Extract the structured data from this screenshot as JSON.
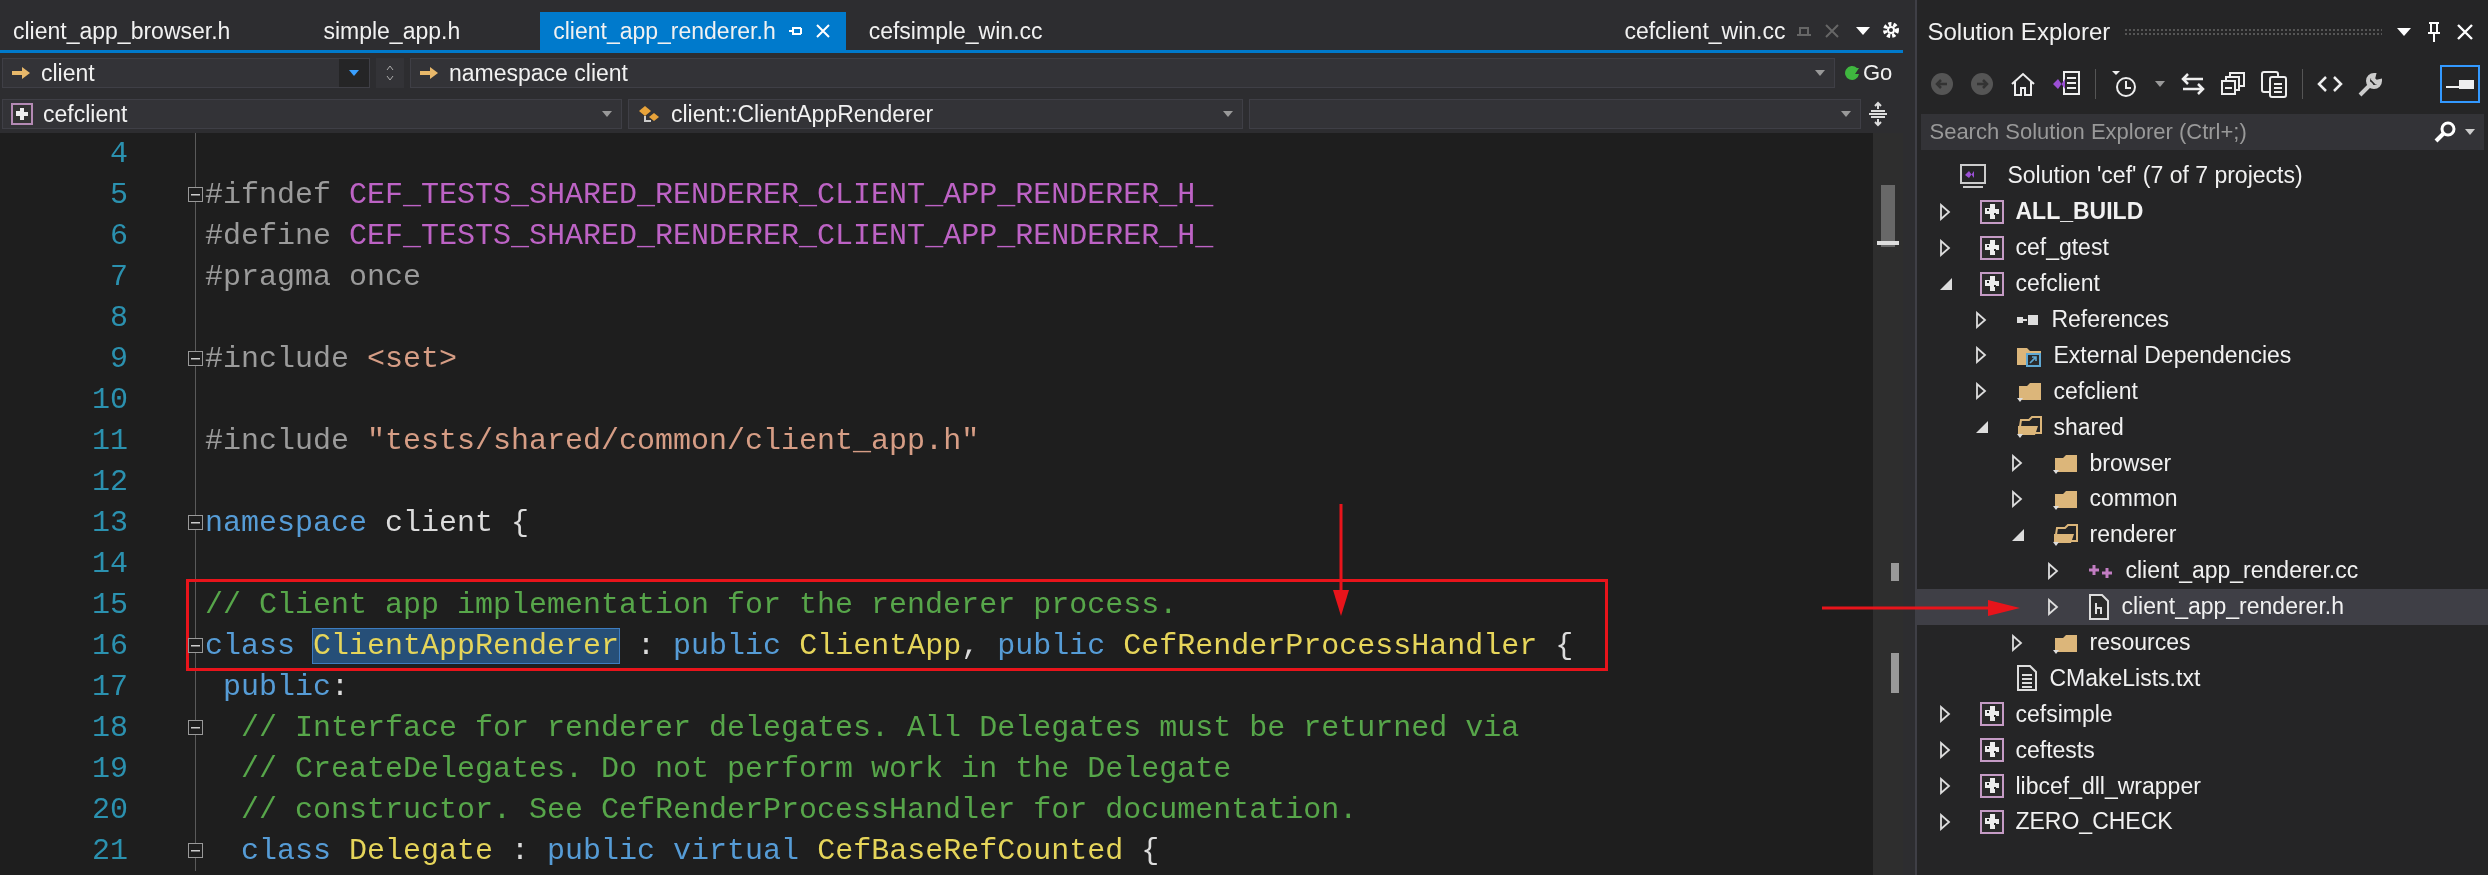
{
  "tabs": [
    {
      "label": "client_app_browser.h",
      "selected": false,
      "preview": false
    },
    {
      "label": "simple_app.h",
      "selected": false,
      "preview": false
    },
    {
      "label": "client_app_renderer.h",
      "selected": true,
      "preview": false
    },
    {
      "label": "cefsimple_win.cc",
      "selected": false,
      "preview": false
    },
    {
      "label": "cefclient_win.cc",
      "selected": false,
      "preview": true
    }
  ],
  "navigation_bar": {
    "scope": "client",
    "member": "namespace client",
    "go_button": "Go"
  },
  "context_bar": {
    "project": "cefclient",
    "type": "client::ClientAppRenderer"
  },
  "code_lines": [
    {
      "number": "4",
      "collapsible": false
    },
    {
      "number": "5",
      "collapsible": true,
      "tokens": [
        {
          "kind": "preproc",
          "text": "#ifndef "
        },
        {
          "kind": "macro",
          "text": "CEF_TESTS_SHARED_RENDERER_CLIENT_APP_RENDERER_H_"
        }
      ]
    },
    {
      "number": "6",
      "collapsible": false,
      "tokens": [
        {
          "kind": "preproc",
          "text": "#define "
        },
        {
          "kind": "macro",
          "text": "CEF_TESTS_SHARED_RENDERER_CLIENT_APP_RENDERER_H_"
        }
      ]
    },
    {
      "number": "7",
      "collapsible": false,
      "tokens": [
        {
          "kind": "preproc",
          "text": "#pragma once"
        }
      ]
    },
    {
      "number": "8",
      "collapsible": false
    },
    {
      "number": "9",
      "collapsible": true,
      "tokens": [
        {
          "kind": "preproc",
          "text": "#include "
        },
        {
          "kind": "string",
          "text": "<set>"
        }
      ]
    },
    {
      "number": "10",
      "collapsible": false
    },
    {
      "number": "11",
      "collapsible": false,
      "tokens": [
        {
          "kind": "preproc",
          "text": "#include "
        },
        {
          "kind": "string",
          "text": "\"tests/shared/common/client_app.h\""
        }
      ]
    },
    {
      "number": "12",
      "collapsible": false
    },
    {
      "number": "13",
      "collapsible": true,
      "tokens": [
        {
          "kind": "keyword",
          "text": "namespace"
        },
        {
          "kind": "plain",
          "text": " client {"
        }
      ]
    },
    {
      "number": "14",
      "collapsible": false
    },
    {
      "number": "15",
      "collapsible": false,
      "tokens": [
        {
          "kind": "comment",
          "text": "// Client app implementation for the renderer process."
        }
      ]
    },
    {
      "number": "16",
      "collapsible": true,
      "tokens": [
        {
          "kind": "keyword",
          "text": "class "
        },
        {
          "kind": "selection",
          "text": "ClientAppRenderer"
        },
        {
          "kind": "plain",
          "text": " : "
        },
        {
          "kind": "keyword",
          "text": "public "
        },
        {
          "kind": "type",
          "text": "ClientApp"
        },
        {
          "kind": "plain",
          "text": ", "
        },
        {
          "kind": "keyword",
          "text": "public "
        },
        {
          "kind": "type",
          "text": "CefRenderProcessHandler"
        },
        {
          "kind": "plain",
          "text": " {"
        }
      ]
    },
    {
      "number": "17",
      "collapsible": false,
      "tokens": [
        {
          "kind": "keyword",
          "text": " public"
        },
        {
          "kind": "plain",
          "text": ":"
        }
      ]
    },
    {
      "number": "18",
      "collapsible": true,
      "tokens": [
        {
          "kind": "comment",
          "text": "  // Interface for renderer delegates. All Delegates must be returned via"
        }
      ]
    },
    {
      "number": "19",
      "collapsible": false,
      "tokens": [
        {
          "kind": "comment",
          "text": "  // CreateDelegates. Do not perform work in the Delegate"
        }
      ]
    },
    {
      "number": "20",
      "collapsible": false,
      "tokens": [
        {
          "kind": "comment",
          "text": "  // constructor. See CefRenderProcessHandler for documentation."
        }
      ]
    },
    {
      "number": "21",
      "collapsible": true,
      "tokens": [
        {
          "kind": "keyword",
          "text": "  class "
        },
        {
          "kind": "type",
          "text": "Delegate"
        },
        {
          "kind": "plain",
          "text": " : "
        },
        {
          "kind": "keyword",
          "text": "public virtual "
        },
        {
          "kind": "type",
          "text": "CefBaseRefCounted"
        },
        {
          "kind": "plain",
          "text": " {"
        }
      ]
    }
  ],
  "solution_explorer": {
    "title": "Solution Explorer",
    "search": {
      "placeholder": "Search Solution Explorer (Ctrl+;)"
    },
    "solution": {
      "label": "Solution 'cef' (7 of 7 projects)",
      "children": [
        {
          "label": "ALL_BUILD",
          "kind": "startup-project",
          "expanded": false,
          "selected": false
        },
        {
          "label": "cef_gtest",
          "kind": "project",
          "expanded": false,
          "selected": false
        },
        {
          "label": "cefclient",
          "kind": "project",
          "expanded": true,
          "selected": false,
          "children": [
            {
              "label": "References",
              "kind": "references",
              "expanded": false,
              "selected": false
            },
            {
              "label": "External Dependencies",
              "kind": "external",
              "expanded": false,
              "selected": false
            },
            {
              "label": "cefclient",
              "kind": "filter",
              "expanded": false,
              "selected": false
            },
            {
              "label": "shared",
              "kind": "filter",
              "expanded": true,
              "selected": false,
              "children": [
                {
                  "label": "browser",
                  "kind": "filter",
                  "expanded": false,
                  "selected": false
                },
                {
                  "label": "common",
                  "kind": "filter",
                  "expanded": false,
                  "selected": false
                },
                {
                  "label": "renderer",
                  "kind": "filter",
                  "expanded": true,
                  "selected": false,
                  "children": [
                    {
                      "label": "client_app_renderer.cc",
                      "kind": "source",
                      "expanded": false,
                      "selected": false
                    },
                    {
                      "label": "client_app_renderer.h",
                      "kind": "header",
                      "expanded": false,
                      "selected": true
                    }
                  ]
                },
                {
                  "label": "resources",
                  "kind": "filter",
                  "expanded": false,
                  "selected": false
                }
              ]
            },
            {
              "label": "CMakeLists.txt",
              "kind": "text",
              "selected": false
            }
          ]
        },
        {
          "label": "cefsimple",
          "kind": "project",
          "expanded": false,
          "selected": false
        },
        {
          "label": "ceftests",
          "kind": "project",
          "expanded": false,
          "selected": false
        },
        {
          "label": "libcef_dll_wrapper",
          "kind": "project",
          "expanded": false,
          "selected": false
        },
        {
          "label": "ZERO_CHECK",
          "kind": "project",
          "expanded": false,
          "selected": false
        }
      ]
    }
  }
}
